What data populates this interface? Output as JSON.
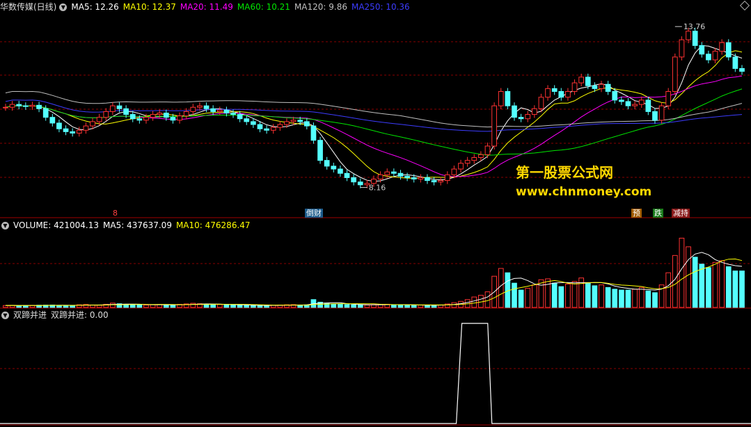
{
  "main_legend": {
    "stock_name": "华数传媒(日线)",
    "ma5": "MA5: 12.26",
    "ma10": "MA10: 12.37",
    "ma20": "MA20: 11.49",
    "ma60": "MA60: 10.21",
    "ma120": "MA120: 9.86",
    "ma250": "MA250: 10.36"
  },
  "volume_legend": {
    "volume": "VOLUME: 421004.13",
    "ma5": "MA5: 437637.09",
    "ma10": "MA10: 476286.47"
  },
  "indicator_legend": {
    "name": "双蹄并进",
    "value": "双蹄并进: 0.00"
  },
  "annotations": {
    "high_label": "13.76",
    "low_label": "8.16",
    "event_left": "8",
    "event_mid": "倒财",
    "event_right1": "预",
    "event_right2": "跌",
    "event_right3": "减持"
  },
  "watermark": {
    "line1": "第一股票公式网",
    "line2": "www.chnmoney.com"
  },
  "colors": {
    "up": "#ff3232",
    "down": "#54ffff",
    "ma5": "#ffffff",
    "ma10": "#ffff00",
    "ma20": "#ff00ff",
    "ma60": "#00e600",
    "ma120": "#c0c0c0",
    "ma250": "#3c3cff",
    "grid": "#8a0000"
  },
  "chart_data": {
    "type": "candlestick",
    "price_range": [
      7.3,
      14.2
    ],
    "high_marker": 13.76,
    "low_marker": 8.16,
    "close": [
      10.95,
      11.05,
      11.0,
      10.98,
      11.02,
      10.9,
      10.6,
      10.4,
      10.2,
      10.1,
      10.05,
      10.15,
      10.3,
      10.45,
      10.6,
      10.8,
      11.0,
      10.9,
      10.7,
      10.55,
      10.5,
      10.6,
      10.7,
      10.75,
      10.6,
      10.5,
      10.65,
      10.8,
      10.95,
      11.0,
      10.9,
      10.8,
      10.85,
      10.75,
      10.7,
      10.55,
      10.45,
      10.35,
      10.2,
      10.15,
      10.25,
      10.35,
      10.45,
      10.5,
      10.45,
      10.3,
      9.8,
      9.1,
      8.9,
      8.8,
      8.65,
      8.5,
      8.35,
      8.25,
      8.3,
      8.45,
      8.6,
      8.7,
      8.65,
      8.55,
      8.5,
      8.45,
      8.5,
      8.4,
      8.35,
      8.4,
      8.6,
      8.8,
      9.0,
      9.1,
      9.2,
      9.3,
      9.6,
      11.0,
      11.5,
      11.0,
      10.6,
      10.55,
      10.7,
      10.9,
      11.3,
      11.6,
      11.5,
      11.3,
      11.5,
      11.8,
      12.0,
      11.7,
      11.6,
      11.75,
      11.5,
      11.2,
      11.15,
      11.0,
      11.05,
      11.2,
      10.8,
      10.5,
      11.0,
      11.5,
      12.7,
      13.3,
      13.6,
      13.1,
      12.8,
      12.6,
      12.9,
      13.2,
      12.7,
      12.3,
      12.2
    ],
    "volume": [
      22000,
      24000,
      20000,
      21000,
      23000,
      25000,
      26000,
      27000,
      24000,
      22000,
      23000,
      30000,
      34000,
      28000,
      25000,
      36000,
      50000,
      42000,
      35000,
      30000,
      28000,
      27000,
      31000,
      33000,
      28000,
      26000,
      35000,
      40000,
      48000,
      42000,
      35000,
      32000,
      34000,
      30000,
      29000,
      26000,
      25000,
      24000,
      22000,
      21000,
      24000,
      26000,
      30000,
      32000,
      28000,
      30000,
      90000,
      60000,
      48000,
      40000,
      36000,
      32000,
      30000,
      28000,
      27000,
      30000,
      34000,
      36000,
      32000,
      28000,
      26000,
      25000,
      27000,
      26000,
      24000,
      28000,
      40000,
      55000,
      70000,
      90000,
      120000,
      140000,
      180000,
      360000,
      450000,
      400000,
      280000,
      200000,
      220000,
      260000,
      320000,
      330000,
      280000,
      240000,
      270000,
      300000,
      340000,
      280000,
      250000,
      260000,
      230000,
      210000,
      200000,
      200000,
      210000,
      230000,
      190000,
      170000,
      260000,
      400000,
      600000,
      800000,
      700000,
      580000,
      500000,
      460000,
      520000,
      540000,
      470000,
      421004,
      421004
    ],
    "indicator": {
      "name": "双蹄并进",
      "signal_window": [
        0.615,
        0.655
      ],
      "values_high": 1,
      "values_low": 0
    }
  }
}
